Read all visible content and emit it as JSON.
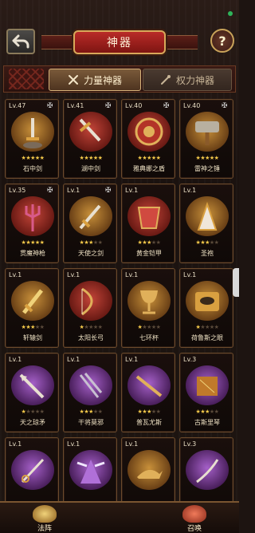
{
  "header": {
    "title": "神器"
  },
  "tabs": [
    {
      "label": "力量神器",
      "active": true
    },
    {
      "label": "权力神器",
      "active": false
    }
  ],
  "artifacts": [
    {
      "level": "Lv.47",
      "name": "石中剑",
      "stars": 5,
      "locked": true,
      "orb": "gold",
      "icon": "sword-in-stone-icon"
    },
    {
      "level": "Lv.41",
      "name": "湖中剑",
      "stars": 5,
      "locked": true,
      "orb": "red",
      "icon": "lake-sword-icon"
    },
    {
      "level": "Lv.40",
      "name": "雅典娜之盾",
      "stars": 5,
      "locked": true,
      "orb": "red",
      "icon": "athena-shield-icon"
    },
    {
      "level": "Lv.40",
      "name": "雷神之锤",
      "stars": 5,
      "locked": true,
      "orb": "gold",
      "icon": "thor-hammer-icon"
    },
    {
      "level": "Lv.35",
      "name": "贯魔神枪",
      "stars": 5,
      "locked": true,
      "orb": "red",
      "icon": "trident-icon"
    },
    {
      "level": "Lv.1",
      "name": "天使之剑",
      "stars": 3,
      "locked": true,
      "orb": "gold",
      "icon": "angel-sword-icon"
    },
    {
      "level": "Lv.1",
      "name": "黄金铠甲",
      "stars": 3,
      "locked": false,
      "orb": "red",
      "icon": "golden-armor-icon"
    },
    {
      "level": "Lv.1",
      "name": "圣袍",
      "stars": 3,
      "locked": false,
      "orb": "gold",
      "icon": "holy-robe-icon"
    },
    {
      "level": "Lv.1",
      "name": "轩辕剑",
      "stars": 3,
      "locked": false,
      "orb": "gold",
      "icon": "xuanyuan-sword-icon"
    },
    {
      "level": "Lv.1",
      "name": "太阳长弓",
      "stars": 1,
      "locked": false,
      "orb": "red",
      "icon": "sun-bow-icon"
    },
    {
      "level": "Lv.1",
      "name": "七环杯",
      "stars": 1,
      "locked": false,
      "orb": "gold",
      "icon": "chalice-icon"
    },
    {
      "level": "Lv.1",
      "name": "荷鲁斯之眼",
      "stars": 1,
      "locked": false,
      "orb": "gold",
      "icon": "eye-of-horus-icon"
    },
    {
      "level": "Lv.1",
      "name": "天之琼矛",
      "stars": 1,
      "locked": false,
      "orb": "purple",
      "icon": "heavenly-spear-icon"
    },
    {
      "level": "Lv.1",
      "name": "干将莫邪",
      "stars": 3,
      "locked": false,
      "orb": "purple",
      "icon": "twin-swords-icon"
    },
    {
      "level": "Lv.1",
      "name": "普瓦尤斯",
      "stars": 3,
      "locked": false,
      "orb": "purple",
      "icon": "golden-spear-icon"
    },
    {
      "level": "Lv.3",
      "name": "古斯里琴",
      "stars": 3,
      "locked": false,
      "orb": "purple",
      "icon": "gusli-harp-icon"
    },
    {
      "level": "Lv.1",
      "name": "",
      "stars": 0,
      "locked": false,
      "orb": "purple",
      "icon": "rapier-icon"
    },
    {
      "level": "Lv.1",
      "name": "",
      "stars": 0,
      "locked": false,
      "orb": "purple",
      "icon": "winged-cape-icon"
    },
    {
      "level": "Lv.1",
      "name": "",
      "stars": 0,
      "locked": false,
      "orb": "gold",
      "icon": "magic-lamp-icon"
    },
    {
      "level": "Lv.3",
      "name": "",
      "stars": 0,
      "locked": false,
      "orb": "purple",
      "icon": "curved-sword-icon"
    }
  ],
  "bottom": {
    "left_label": "法阵",
    "right_label": "召唤"
  },
  "colors": {
    "accent_red": "#b92b28",
    "gold": "#d9a85a",
    "star_on": "#f2c84a"
  }
}
